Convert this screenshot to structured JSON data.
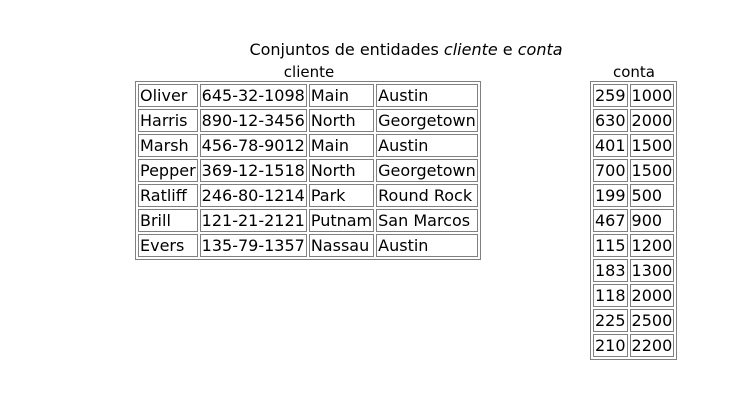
{
  "title": {
    "prefix": "Conjuntos de entidades ",
    "entity1": "cliente",
    "conjunction": " e ",
    "entity2": "conta"
  },
  "cliente": {
    "caption": "cliente",
    "rows": [
      [
        "Oliver",
        "645-32-1098",
        "Main",
        "Austin"
      ],
      [
        "Harris",
        "890-12-3456",
        "North",
        "Georgetown"
      ],
      [
        "Marsh",
        "456-78-9012",
        "Main",
        "Austin"
      ],
      [
        "Pepper",
        "369-12-1518",
        "North",
        "Georgetown"
      ],
      [
        "Ratliff",
        "246-80-1214",
        "Park",
        "Round Rock"
      ],
      [
        "Brill",
        "121-21-2121",
        "Putnam",
        "San Marcos"
      ],
      [
        "Evers",
        "135-79-1357",
        "Nassau",
        "Austin"
      ]
    ]
  },
  "conta": {
    "caption": "conta",
    "rows": [
      [
        "259",
        "1000"
      ],
      [
        "630",
        "2000"
      ],
      [
        "401",
        "1500"
      ],
      [
        "700",
        "1500"
      ],
      [
        "199",
        "500"
      ],
      [
        "467",
        "900"
      ],
      [
        "115",
        "1200"
      ],
      [
        "183",
        "1300"
      ],
      [
        "118",
        "2000"
      ],
      [
        "225",
        "2500"
      ],
      [
        "210",
        "2200"
      ]
    ]
  }
}
